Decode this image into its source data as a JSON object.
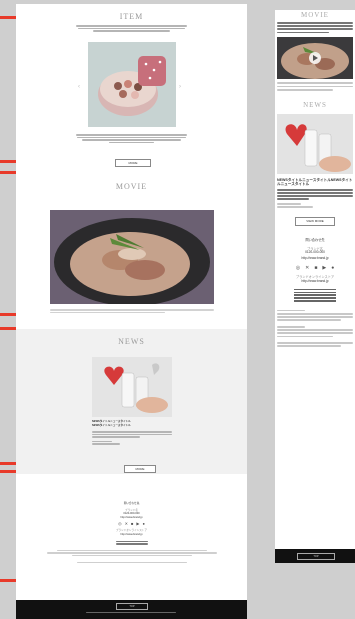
{
  "desktop": {
    "sections": {
      "item": {
        "title": "ITEM",
        "button": "MORE"
      },
      "movie": {
        "title": "MOVIE"
      },
      "news": {
        "title": "NEWS",
        "heading1": "NEWSタイトルニュースタイトル",
        "heading2": "NEWSタイトルニュースタイトル",
        "button": "MORE"
      }
    },
    "footer": {
      "heading": "問い合わせ先",
      "brand": "ブランド名",
      "phone": "0120-000-000",
      "link": "http://www.brand.jp",
      "shop_heading": "ブランドオンラインストア",
      "shop_link": "http://www.brand.jp",
      "bar_button": "TOP"
    }
  },
  "mobile": {
    "movie_title": "MOVIE",
    "news_title": "NEWS",
    "news_heading": "NEWSタイトルニュースタイトルNEWSタイトルニュースタイトル",
    "news_button": "VIEW MORE",
    "footer": {
      "heading": "問い合わせ先",
      "brand": "ブランド名",
      "phone": "0120-000-000",
      "link": "http://www.brand.jp",
      "shop_heading": "ブランドオンラインストア",
      "shop_link": "http://www.brand.jp",
      "bar_button": "TOP"
    }
  }
}
